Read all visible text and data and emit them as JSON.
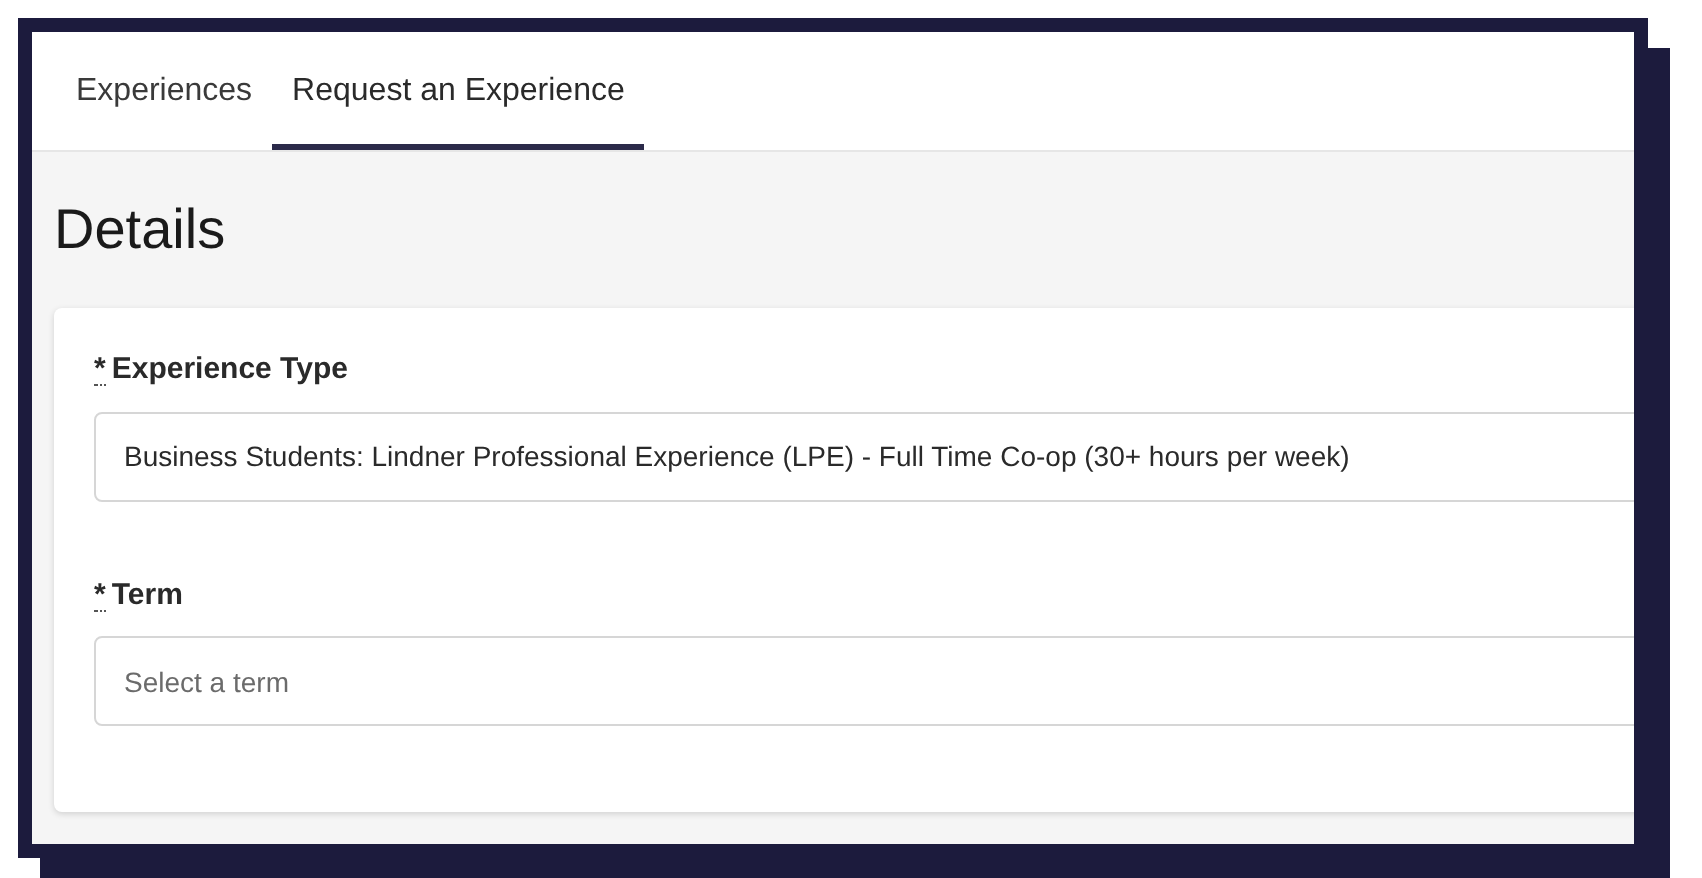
{
  "tabs": [
    {
      "label": "Experiences",
      "selected": false
    },
    {
      "label": "Request an Experience",
      "selected": true
    }
  ],
  "heading": "Details",
  "fields": [
    {
      "required_mark": "*",
      "label": "Experience Type",
      "value": "Business Students: Lindner Professional Experience (LPE) - Full Time Co-op (30+ hours per week)"
    },
    {
      "required_mark": "*",
      "label": "Term",
      "placeholder": "Select a term"
    }
  ]
}
